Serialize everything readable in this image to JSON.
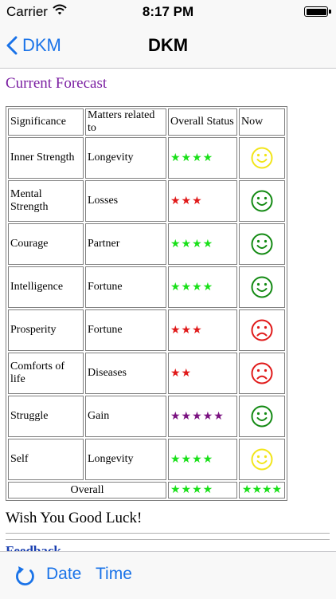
{
  "status_bar": {
    "carrier": "Carrier",
    "time": "8:17 PM"
  },
  "nav": {
    "back_label": "DKM",
    "title": "DKM"
  },
  "forecast": {
    "title": "Current Forecast",
    "headers": [
      "Significance",
      "Matters related to",
      "Overall Status",
      "Now"
    ],
    "rows": [
      {
        "significance": "Inner Strength",
        "matters": "Longevity",
        "stars": "★★★★",
        "star_color": "#19e019",
        "mood": "happy",
        "mood_color": "#f2e51a"
      },
      {
        "significance": "Mental Strength",
        "matters": "Losses",
        "stars": "★★★",
        "star_color": "#e01919",
        "mood": "happy",
        "mood_color": "#138a13"
      },
      {
        "significance": "Courage",
        "matters": "Partner",
        "stars": "★★★★",
        "star_color": "#19e019",
        "mood": "happy",
        "mood_color": "#138a13"
      },
      {
        "significance": "Intelligence",
        "matters": "Fortune",
        "stars": "★★★★",
        "star_color": "#19e019",
        "mood": "happy",
        "mood_color": "#138a13"
      },
      {
        "significance": "Prosperity",
        "matters": "Fortune",
        "stars": "★★★",
        "star_color": "#e01919",
        "mood": "sad",
        "mood_color": "#e01919"
      },
      {
        "significance": "Comforts of life",
        "matters": "Diseases",
        "stars": "★★",
        "star_color": "#e01919",
        "mood": "sad",
        "mood_color": "#e01919"
      },
      {
        "significance": "Struggle",
        "matters": "Gain",
        "stars": "★★★★★",
        "star_color": "#7a1180",
        "mood": "happy",
        "mood_color": "#138a13"
      },
      {
        "significance": "Self",
        "matters": "Longevity",
        "stars": "★★★★",
        "star_color": "#19e019",
        "mood": "happy",
        "mood_color": "#f2e51a"
      }
    ],
    "overall": {
      "label": "Overall",
      "status_stars": "★★★★",
      "now_stars": "★★★★",
      "star_color": "#19e019"
    }
  },
  "wish": "Wish You Good Luck!",
  "feedback": "Feedback",
  "tab_bar": {
    "date_label": "Date",
    "time_label": "Time"
  },
  "colors": {
    "accent": "#1a73e8",
    "section_title": "#7b1fa2",
    "bar_bg": "#f8f8f8"
  }
}
